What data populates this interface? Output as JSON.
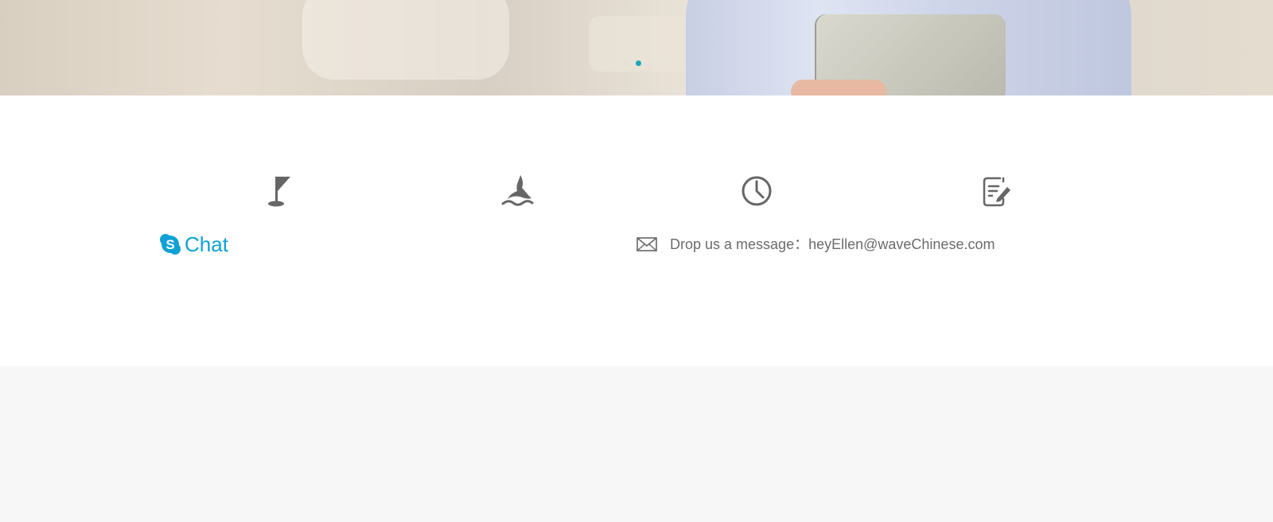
{
  "carousel": {
    "dots": 2,
    "active_index": 1,
    "accent_color": "#19a8b8"
  },
  "features": {
    "icons": [
      "flag-icon",
      "swimmer-icon",
      "clock-icon",
      "edit-note-icon"
    ],
    "icon_color": "#666666"
  },
  "contact": {
    "chat_label": "Chat",
    "chat_icon": "skype-icon",
    "chat_color": "#0fa1d6",
    "email_icon": "envelope-icon",
    "email_text": "Drop us a message：heyEllen@waveChinese.com"
  },
  "colors": {
    "page_bg": "#f7f7f7",
    "section_bg": "#ffffff",
    "text_gray": "#6b6b6b"
  }
}
